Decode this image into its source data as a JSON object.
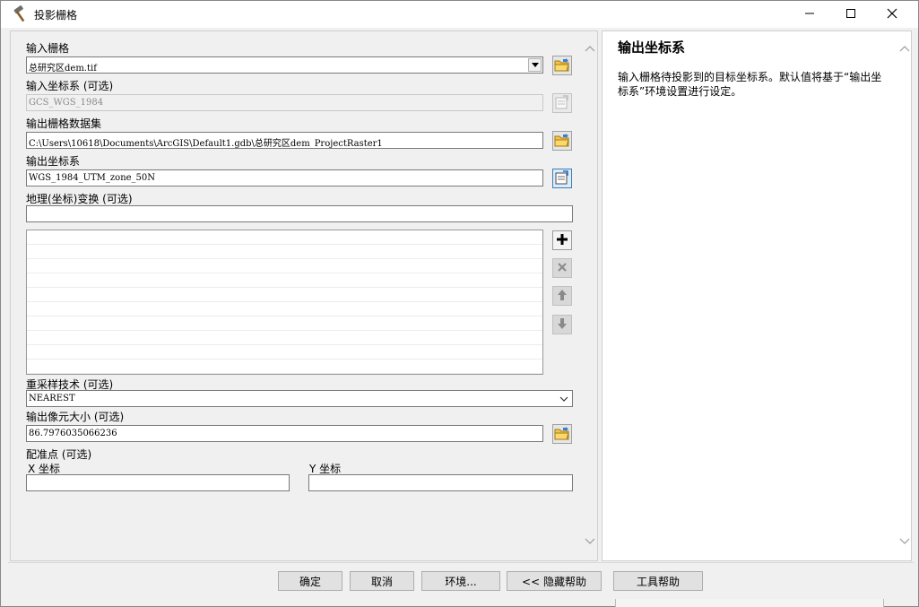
{
  "window": {
    "title": "投影栅格",
    "title_icon": "hammer-icon",
    "minimize_icon": "minimize-icon",
    "maximize_icon": "maximize-icon",
    "close_icon": "close-icon"
  },
  "form": {
    "input_raster": {
      "label": "输入栅格",
      "value": "总研究区dem.tif",
      "button_icon": "open-folder-icon"
    },
    "input_coord": {
      "label": "输入坐标系 (可选)",
      "value": "GCS_WGS_1984",
      "button_icon": "coordinate-system-icon"
    },
    "output_raster": {
      "label": "输出栅格数据集",
      "value": "C:\\Users\\10618\\Documents\\ArcGIS\\Default1.gdb\\总研究区dem_ProjectRaster1",
      "button_icon": "open-folder-icon"
    },
    "output_coord": {
      "label": "输出坐标系",
      "value": "WGS_1984_UTM_zone_50N",
      "button_icon": "coordinate-system-icon"
    },
    "geo_transform": {
      "label": "地理(坐标)变换 (可选)",
      "value": "",
      "list_items": [],
      "add_icon": "plus-icon",
      "remove_icon": "x-icon",
      "up_icon": "arrow-up-icon",
      "down_icon": "arrow-down-icon"
    },
    "resampling": {
      "label": "重采样技术 (可选)",
      "value": "NEAREST"
    },
    "cell_size": {
      "label": "输出像元大小 (可选)",
      "value": "86.7976035066236",
      "button_icon": "open-folder-icon"
    },
    "registration_point": {
      "label": "配准点 (可选)",
      "x_label": "X 坐标",
      "y_label": "Y 坐标",
      "x_value": "",
      "y_value": ""
    }
  },
  "help": {
    "title": "输出坐标系",
    "body": "输入栅格待投影到的目标坐标系。默认值将基于“输出坐标系”环境设置进行设定。"
  },
  "footer": {
    "ok": "确定",
    "cancel": "取消",
    "environments": "环境...",
    "hide_help": "<< 隐藏帮助",
    "tool_help": "工具帮助"
  }
}
